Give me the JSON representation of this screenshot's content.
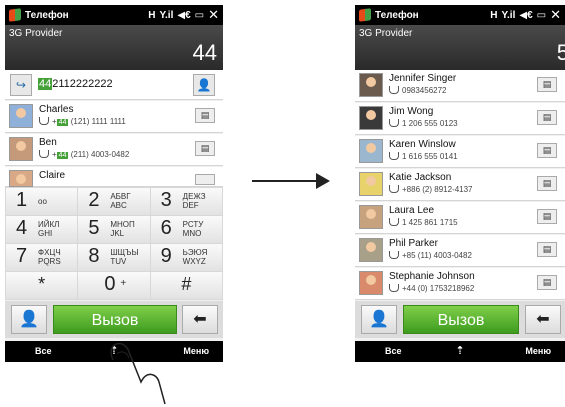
{
  "left_phone": {
    "status": {
      "app_title": "Телефон",
      "icons": [
        "H",
        "Y.il",
        "◀€",
        "▭",
        "✕"
      ]
    },
    "provider": "3G Provider",
    "count": "44",
    "dial_input": {
      "highlight": "44",
      "rest": "2112222222"
    },
    "contacts": [
      {
        "name": "Charles",
        "country_code": "44",
        "phone": "(121) 1111 1111"
      },
      {
        "name": "Ben",
        "country_code": "44",
        "phone": "(211) 4003-0482"
      },
      {
        "name": "Claire",
        "country_code": "",
        "phone": ""
      }
    ],
    "keypad": [
      {
        "digit": "1",
        "letters": "oo"
      },
      {
        "digit": "2",
        "letters": "АБВГ ABC"
      },
      {
        "digit": "3",
        "letters": "ДЕЖЗ DEF"
      },
      {
        "digit": "4",
        "letters": "ИЙКЛ GHI"
      },
      {
        "digit": "5",
        "letters": "МНОП JKL"
      },
      {
        "digit": "6",
        "letters": "РСТУ MNO"
      },
      {
        "digit": "7",
        "letters": "ФХЦЧ PQRS"
      },
      {
        "digit": "8",
        "letters": "ШЩЪЫ TUV"
      },
      {
        "digit": "9",
        "letters": "ЬЭЮЯ WXYZ"
      },
      {
        "digit": "*",
        "letters": ""
      },
      {
        "digit": "0",
        "letters": "+"
      },
      {
        "digit": "#",
        "letters": ""
      }
    ],
    "call_label": "Вызов",
    "softkeys": {
      "left": "Все",
      "center": "⇡",
      "right": "Меню"
    }
  },
  "right_phone": {
    "status": {
      "app_title": "Телефон",
      "icons": [
        "H",
        "Y.il",
        "◀€",
        "▭",
        "✕"
      ]
    },
    "provider": "3G Provider",
    "count": "5",
    "contacts": [
      {
        "name": "Jennifer Singer",
        "phone": "0983456272"
      },
      {
        "name": "Jim Wong",
        "phone": "1 206 555 0123"
      },
      {
        "name": "Karen Winslow",
        "phone": "1 616 555 0141"
      },
      {
        "name": "Katie Jackson",
        "phone": "+886 (2) 8912-4137"
      },
      {
        "name": "Laura Lee",
        "phone": "1 425 861 1715"
      },
      {
        "name": "Phil Parker",
        "phone": "+85 (11) 4003-0482"
      },
      {
        "name": "Stephanie Johnson",
        "phone": "+44 (0) 1753218962"
      }
    ],
    "call_label": "Вызов",
    "softkeys": {
      "left": "Все",
      "center": "⇡",
      "right": "Меню"
    }
  },
  "colors": {
    "accent_green": "#46a03a",
    "bar_black": "#000000",
    "header_gray": "#3a3a3a"
  },
  "icons": [
    "windows-logo-icon",
    "call-forward-icon",
    "person-icon",
    "contact-card-icon",
    "backspace-icon",
    "arrow-right-icon"
  ]
}
